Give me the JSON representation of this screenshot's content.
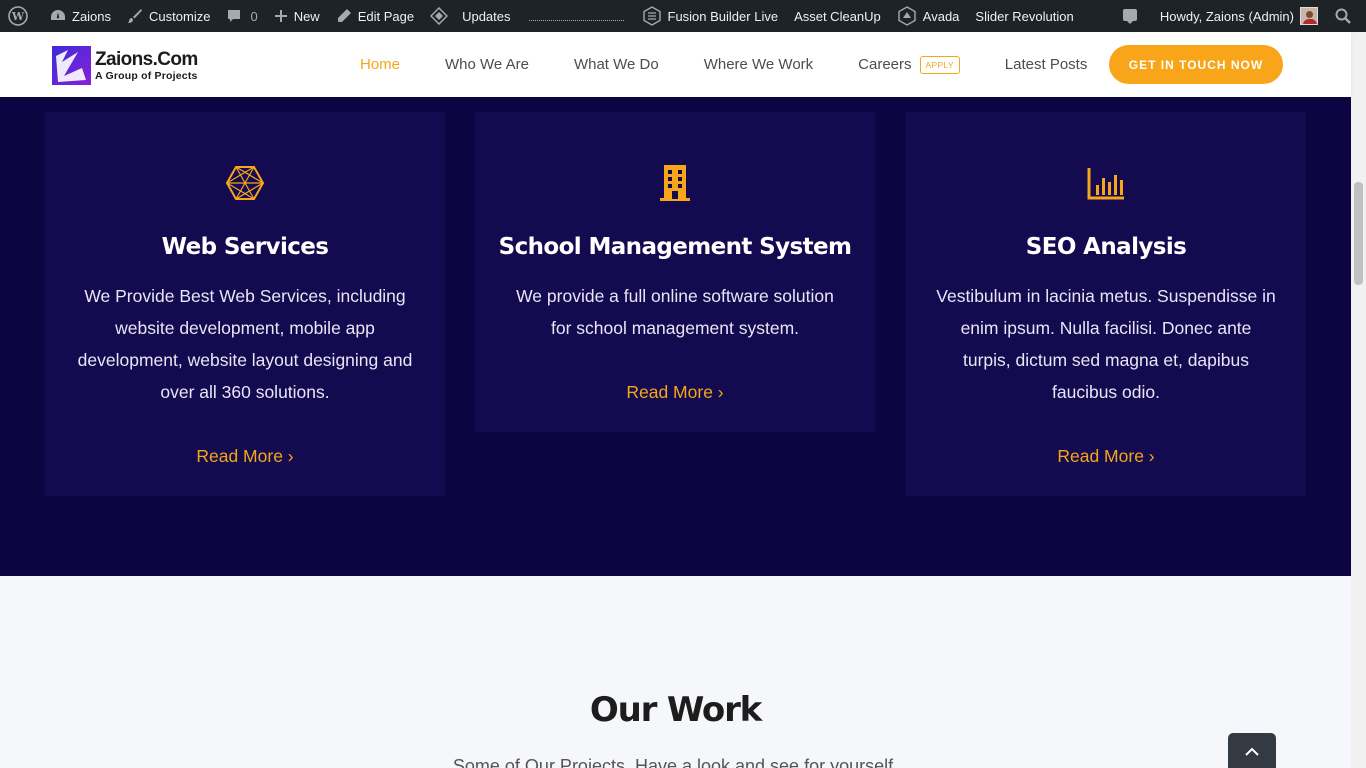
{
  "adminbar": {
    "site": "Zaions",
    "customize": "Customize",
    "comments_count": "0",
    "new": "New",
    "edit_page": "Edit Page",
    "updates": "Updates",
    "fusion_builder": "Fusion Builder Live",
    "asset_cleanup": "Asset CleanUp",
    "avada": "Avada",
    "slider_revolution": "Slider Revolution",
    "howdy": "Howdy, Zaions (Admin)"
  },
  "header": {
    "logo_name": "Zaions.Com",
    "logo_tagline": "A Group of Projects",
    "nav": [
      {
        "label": "Home",
        "active": true
      },
      {
        "label": "Who We Are"
      },
      {
        "label": "What We Do"
      },
      {
        "label": "Where We Work"
      },
      {
        "label": "Careers",
        "badge": "APPLY"
      },
      {
        "label": "Latest Posts"
      }
    ],
    "cta": "GET IN TOUCH NOW"
  },
  "services": [
    {
      "icon": "hexagon-network-icon",
      "title": "Web Services",
      "text": "We Provide Best Web Services, including website development, mobile app development, website layout designing and over all 360 solutions.",
      "link": "Read More ›"
    },
    {
      "icon": "building-icon",
      "title": "School Management System",
      "text": "We provide a full online software solution for school management system.",
      "link": "Read More ›"
    },
    {
      "icon": "bar-chart-icon",
      "title": "SEO Analysis",
      "text": "Vestibulum in lacinia metus. Suspendisse in enim ipsum. Nulla facilisi. Donec ante turpis, dictum sed magna et, dapibus faucibus odio.",
      "link": "Read More ›"
    }
  ],
  "our_work": {
    "title": "Our Work",
    "subtitle": "Some of Our Projects. Have a look and see for yourself."
  },
  "colors": {
    "accent": "#f6a61b",
    "section_bg": "#0c0541",
    "card_bg": "#130a4f"
  }
}
